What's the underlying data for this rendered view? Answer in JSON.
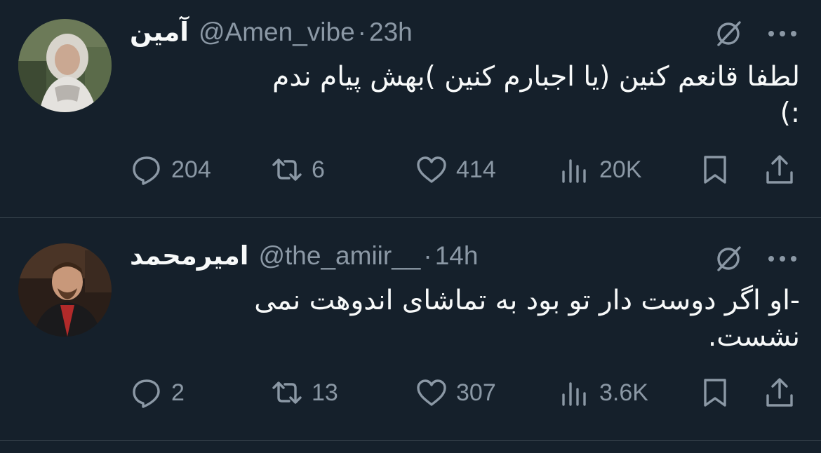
{
  "tweets": [
    {
      "name": "آمین",
      "handle": "@Amen_vibe",
      "separator": "·",
      "time": "23h",
      "text_lines": [
        "لطفا قانعم کنین (یا اجبارم کنین )بهش پیام ندم",
        ":)"
      ],
      "replies": "204",
      "retweets": "6",
      "likes": "414",
      "views": "20K"
    },
    {
      "name": "امیرمحمد",
      "handle": "@the_amiir__",
      "separator": "·",
      "time": "14h",
      "text_lines": [
        "-او اگر دوست دار تو بود به تماشای اندوهت نمی",
        "نشست."
      ],
      "replies": "2",
      "retweets": "13",
      "likes": "307",
      "views": "3.6K"
    }
  ],
  "icons": {
    "reply": "reply-icon",
    "retweet": "retweet-icon",
    "like": "heart-icon",
    "views": "views-chart-icon",
    "bookmark": "bookmark-icon",
    "share": "share-icon",
    "grok": "grok-icon",
    "more": "more-dots-icon"
  },
  "colors": {
    "background": "#15202b",
    "text": "#f7f9f9",
    "muted": "#8b98a5",
    "divider": "#38444d"
  }
}
